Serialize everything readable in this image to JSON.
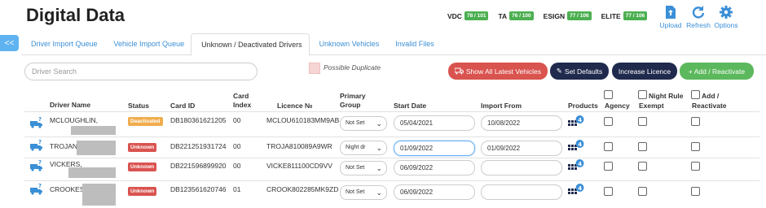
{
  "app": {
    "title": "Digital Data"
  },
  "licences": [
    {
      "label": "VDC",
      "value": "78 / 101"
    },
    {
      "label": "TA",
      "value": "76 / 100"
    },
    {
      "label": "ESIGN",
      "value": "77 / 106"
    },
    {
      "label": "ELITE",
      "value": "77 / 106"
    }
  ],
  "toolbar": {
    "upload": "Upload",
    "refresh": "Refresh",
    "options": "Options"
  },
  "collapse_label": "<<",
  "tabs": [
    {
      "label": "Driver Import Queue"
    },
    {
      "label": "Vehicle Import Queue"
    },
    {
      "label": "Unknown / Deactivated Drivers"
    },
    {
      "label": "Unknown Vehicles"
    },
    {
      "label": "Invalid Files"
    }
  ],
  "search": {
    "placeholder": "Driver Search"
  },
  "legend": {
    "possible_duplicate": "Possible Duplicate"
  },
  "actions": {
    "show_all": "Show All Latest Vehicles",
    "set_defaults": "Set Defaults",
    "increase_licence": "Increase Licence",
    "add_reactivate": "+ Add / Reactivate"
  },
  "columns": {
    "driver_name": "Driver Name",
    "status": "Status",
    "card_id": "Card ID",
    "card_index_1": "Card",
    "card_index_2": "Index",
    "licence": "Licence №",
    "primary_1": "Primary",
    "primary_2": "Group",
    "start_date": "Start Date",
    "import_from": "Import From",
    "products": "Products",
    "agency": "Agency",
    "night_1": "Night Rule",
    "night_2": "Exempt",
    "addreact_1": "Add /",
    "addreact_2": "Reactivate"
  },
  "rows": [
    {
      "name": "MCLOUGHLIN,",
      "status": "Deactivated",
      "card_id": "DB180361621205",
      "card_index": "00",
      "licence": "MCLOU610183MM9AB",
      "group": "Not Set",
      "start": "05/04/2021",
      "import_from": "10/08/2022",
      "products": "4"
    },
    {
      "name": "TROJAN",
      "status": "Unknown",
      "card_id": "DB221251931724",
      "card_index": "00",
      "licence": "TROJA810089A9WR",
      "group": "Night dr",
      "start": "01/09/2022",
      "import_from": "01/09/2022",
      "products": "4"
    },
    {
      "name": "VICKERS,",
      "status": "Unknown",
      "card_id": "DB221596899920",
      "card_index": "00",
      "licence": "VICKE811100CD9VV",
      "group": "Not Set",
      "start": "06/09/2022",
      "import_from": "",
      "products": "4"
    },
    {
      "name": "CROOKES,",
      "status": "Unknown",
      "card_id": "DB123561620746",
      "card_index": "01",
      "licence": "CROOK802285MK9ZD",
      "group": "Not Set",
      "start": "06/09/2022",
      "import_from": "",
      "products": "4"
    }
  ],
  "colors": {
    "accent": "#3b8fd6",
    "deactivated": "#f0ad4e",
    "unknown": "#d9534f",
    "badge": "#4caf50",
    "navy": "#1f2a4d"
  }
}
